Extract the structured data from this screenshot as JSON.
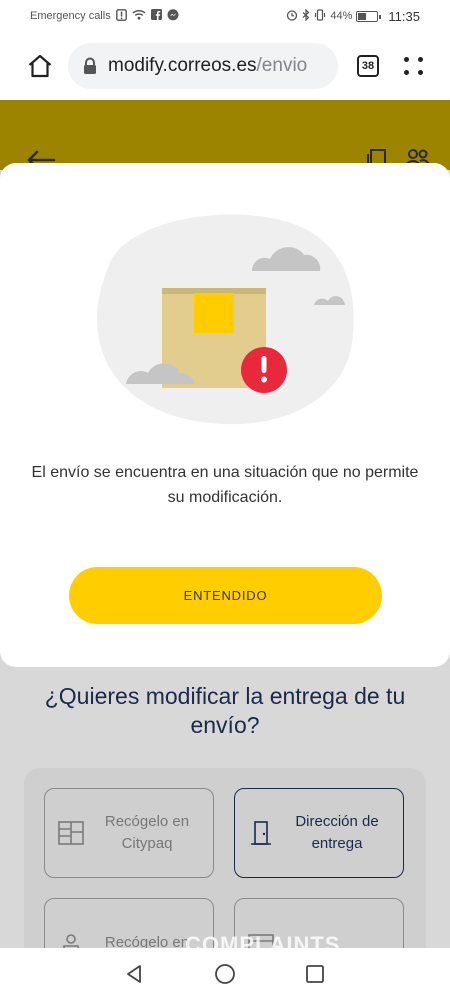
{
  "status_bar": {
    "carrier_text": "Emergency calls",
    "battery": "44%",
    "battery_level": 0.44,
    "time": "11:35"
  },
  "browser": {
    "url_host": "modify.correos.es",
    "url_path": "/envio",
    "tab_count": "38"
  },
  "modal": {
    "message": "El envío se encuentra en una situación que no permite su modificación.",
    "button_label": "ENTENDIDO"
  },
  "page": {
    "question": "¿Quieres modificar la entrega de tu envío?",
    "options": [
      {
        "label": "Recógelo en Citypaq"
      },
      {
        "label": "Dirección de entrega"
      },
      {
        "label": "Recógelo en"
      },
      {
        "label": ""
      }
    ]
  },
  "watermark": "COMPLAINTS",
  "colors": {
    "accent_yellow": "#ffcd00",
    "header_dim": "#9c8400",
    "alert_red": "#e8293b",
    "navy": "#1b2a4a"
  }
}
